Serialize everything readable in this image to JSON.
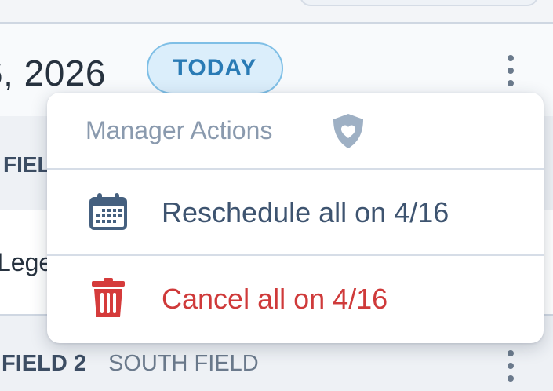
{
  "header": {
    "date_partial": "6, 2026",
    "today_badge": "TODAY"
  },
  "background_rows": {
    "field1_label_partial": "FIEL",
    "game_text_partial": "Lege",
    "field2_label_partial": "FIELD 2",
    "field2_sublabel": "SOUTH FIELD"
  },
  "menu": {
    "header_label": "Manager Actions",
    "header_icon": "shield-heart-icon",
    "items": [
      {
        "label": "Reschedule all on 4/16",
        "icon": "calendar-icon",
        "color": "#3e5470"
      },
      {
        "label": "Cancel all on 4/16",
        "icon": "trash-icon",
        "color": "#cf3a3a"
      }
    ]
  },
  "colors": {
    "accent_blue": "#2a7bb5",
    "badge_bg": "#dbeefb",
    "danger_red": "#cf3a3a",
    "text_dark": "#27323f",
    "muted": "#8a9aae"
  }
}
